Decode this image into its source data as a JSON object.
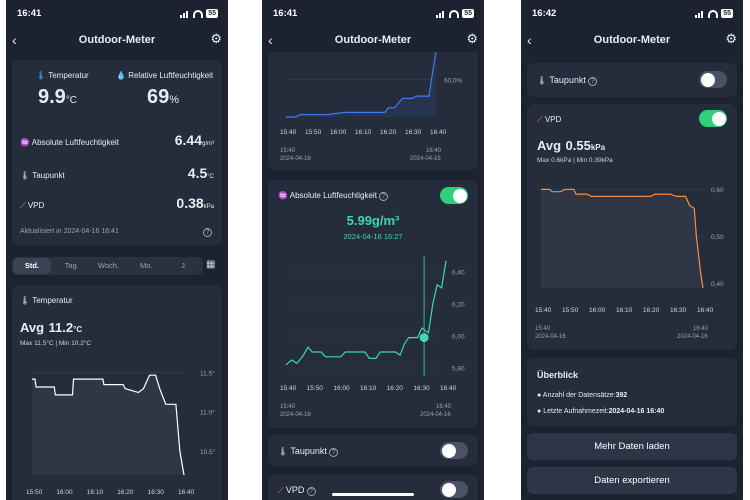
{
  "screens": [
    {
      "time": "16:41",
      "title": "Outdoor-Meter",
      "battery": "55",
      "summary": {
        "temp_label": "Temperatur",
        "temp_value": "9.9",
        "temp_unit": "°C",
        "hum_label": "Relative Luftfeuchtigkeit",
        "hum_value": "69",
        "hum_unit": "%",
        "abs_label": "Absolute Luftfeuchtigkeit",
        "abs_value": "6.44",
        "abs_unit": "g/m³",
        "dew_label": "Taupunkt",
        "dew_value": "4.5",
        "dew_unit": "°C",
        "vpd_label": "VPD",
        "vpd_value": "0.38",
        "vpd_unit": "kPa",
        "updated": "Aktualisiert in 2024-04-16 16:41"
      },
      "tabs": [
        "Std.",
        "Tag",
        "Woch.",
        "Mo.",
        "J."
      ],
      "chart": {
        "label": "Temperatur",
        "avg_prefix": "Avg",
        "avg_value": "11.2",
        "avg_unit": "°C",
        "max": "Max 11.5°C",
        "min": "Min 10.2°C"
      }
    },
    {
      "time": "16:41",
      "title": "Outdoor-Meter",
      "battery": "55",
      "abs_card": {
        "label": "Absolute Luftfeuchtigkeit",
        "value": "5.99g/m³",
        "timestamp": "2024-04-16 16:27"
      },
      "dew_label": "Taupunkt",
      "vpd_label": "VPD"
    },
    {
      "time": "16:42",
      "title": "Outdoor-Meter",
      "battery": "55",
      "dew_label": "Taupunkt",
      "vpd_card": {
        "label": "VPD",
        "avg_prefix": "Avg",
        "avg_value": "0.55",
        "avg_unit": "kPa",
        "max": "Max 0.6kPa",
        "min": "Min 0.39kPa"
      },
      "overview": {
        "title": "Überblick",
        "count_label": "Anzahl der Datensätze:",
        "count_value": "392",
        "last_label": "Letzte Aufnahmezeit:",
        "last_value": "2024-04-16 16:40"
      },
      "buttons": [
        "Mehr Daten laden",
        "Daten exportieren"
      ]
    }
  ],
  "chart_data": [
    {
      "type": "line",
      "title": "Temperatur",
      "x": [
        "16:00",
        "16:05",
        "16:10",
        "16:15",
        "16:20",
        "16:25",
        "16:30",
        "16:35",
        "16:40"
      ],
      "x_ticks": [
        "15:50",
        "16:00",
        "16:10",
        "16:20",
        "16:30",
        "16:40"
      ],
      "y_ticks": [
        "11.5°",
        "11.0°",
        "10.5°"
      ],
      "ylim": [
        10.2,
        11.6
      ],
      "points": [
        [
          0,
          11.42
        ],
        [
          3,
          11.42
        ],
        [
          4,
          11.32
        ],
        [
          22,
          11.32
        ],
        [
          23,
          11.22
        ],
        [
          40,
          11.22
        ],
        [
          41,
          11.42
        ],
        [
          70,
          11.42
        ],
        [
          71,
          11.35
        ],
        [
          90,
          11.35
        ],
        [
          92,
          11.3
        ],
        [
          105,
          11.25
        ],
        [
          110,
          11.3
        ],
        [
          116,
          11.47
        ],
        [
          122,
          11.47
        ],
        [
          126,
          11.3
        ],
        [
          132,
          11.1
        ],
        [
          142,
          11.1
        ],
        [
          146,
          10.5
        ],
        [
          150,
          10.2
        ]
      ]
    },
    {
      "type": "line",
      "title": "Relative Luftfeuchtigkeit",
      "x_ticks": [
        "15:40",
        "15:50",
        "16:00",
        "16:10",
        "16:20",
        "16:30",
        "16:40"
      ],
      "x_labels_bottom": [
        "15:40 2024-04-16",
        "16:40 2024-04-16"
      ],
      "y_ticks": [
        "60,0%"
      ],
      "points": [
        [
          0,
          58.4
        ],
        [
          10,
          58.4
        ],
        [
          14,
          58.5
        ],
        [
          40,
          58.5
        ],
        [
          60,
          58.6
        ],
        [
          100,
          58.6
        ],
        [
          104,
          58.8
        ],
        [
          110,
          58.8
        ],
        [
          118,
          59.2
        ],
        [
          128,
          59.2
        ],
        [
          132,
          59.3
        ],
        [
          145,
          59.3
        ],
        [
          148,
          60.2
        ],
        [
          152,
          61.2
        ]
      ]
    },
    {
      "type": "line",
      "title": "Absolute Luftfeuchtigkeit",
      "x_ticks": [
        "15:40",
        "15:50",
        "16:00",
        "16:10",
        "16:20",
        "16:30",
        "16:40"
      ],
      "x_labels_bottom": [
        "15:40 2024-04-16",
        "16:40 2024-04-16"
      ],
      "y_ticks": [
        "6,40",
        "6,20",
        "6,00",
        "5,80"
      ],
      "ylim": [
        5.75,
        6.5
      ],
      "selected": {
        "x": "16:27",
        "y": 5.99
      },
      "points": [
        [
          0,
          5.82
        ],
        [
          5,
          5.85
        ],
        [
          10,
          5.83
        ],
        [
          16,
          5.88
        ],
        [
          20,
          5.93
        ],
        [
          24,
          5.9
        ],
        [
          32,
          5.9
        ],
        [
          36,
          5.87
        ],
        [
          50,
          5.87
        ],
        [
          54,
          5.9
        ],
        [
          72,
          5.9
        ],
        [
          76,
          5.86
        ],
        [
          82,
          5.86
        ],
        [
          86,
          5.9
        ],
        [
          100,
          5.9
        ],
        [
          104,
          5.88
        ],
        [
          108,
          5.95
        ],
        [
          112,
          5.99
        ],
        [
          120,
          5.99
        ],
        [
          124,
          6.05
        ],
        [
          130,
          6.02
        ],
        [
          134,
          6.2
        ],
        [
          138,
          6.32
        ],
        [
          142,
          6.3
        ],
        [
          146,
          6.47
        ]
      ]
    },
    {
      "type": "line",
      "title": "VPD",
      "x_ticks": [
        "15:40",
        "15:50",
        "16:00",
        "16:10",
        "16:20",
        "16:30",
        "16:40"
      ],
      "x_labels_bottom": [
        "15:40 2024-04-16",
        "16:40 2024-04-16"
      ],
      "y_ticks": [
        "0,60",
        "0,50",
        "0,40"
      ],
      "ylim": [
        0.39,
        0.62
      ],
      "points": [
        [
          0,
          0.6
        ],
        [
          8,
          0.6
        ],
        [
          10,
          0.595
        ],
        [
          18,
          0.595
        ],
        [
          22,
          0.6
        ],
        [
          30,
          0.6
        ],
        [
          32,
          0.59
        ],
        [
          42,
          0.59
        ],
        [
          46,
          0.585
        ],
        [
          100,
          0.585
        ],
        [
          104,
          0.59
        ],
        [
          118,
          0.59
        ],
        [
          124,
          0.585
        ],
        [
          132,
          0.585
        ],
        [
          136,
          0.565
        ],
        [
          140,
          0.56
        ],
        [
          142,
          0.5
        ],
        [
          146,
          0.42
        ],
        [
          148,
          0.39
        ]
      ]
    }
  ]
}
